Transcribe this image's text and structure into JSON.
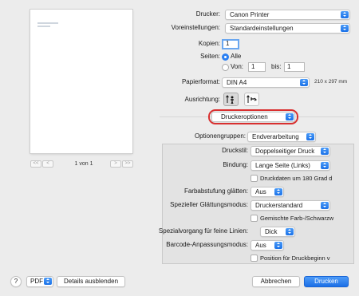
{
  "preview": {
    "first_btn": "<<",
    "prev_btn": "<",
    "page_label": "1 von 1",
    "next_btn": ">",
    "last_btn": ">>"
  },
  "printer": {
    "label": "Drucker:",
    "value": "Canon Printer"
  },
  "presets": {
    "label": "Voreinstellungen:",
    "value": "Standardeinstellungen"
  },
  "copies": {
    "label": "Kopien:",
    "value": "1"
  },
  "pages": {
    "label": "Seiten:",
    "all_label": "Alle",
    "from_label": "Von:",
    "from_value": "1",
    "to_label": "bis:",
    "to_value": "1"
  },
  "paper": {
    "label": "Papierformat:",
    "value": "DIN A4",
    "dimensions": "210 x 297 mm"
  },
  "orientation": {
    "label": "Ausrichtung:"
  },
  "section_menu": {
    "value": "Druckeroptionen"
  },
  "option_groups": {
    "label": "Optionengruppen:",
    "value": "Endverarbeitung"
  },
  "options": {
    "print_style": {
      "label": "Druckstil:",
      "value": "Doppelseitiger Druck"
    },
    "binding": {
      "label": "Bindung:",
      "value": "Lange Seite (Links)"
    },
    "rotate_180": {
      "label": "Druckdaten um 180 Grad d"
    },
    "gradation_smooth": {
      "label": "Farbabstufung glätten:",
      "value": "Aus"
    },
    "special_smoothing": {
      "label": "Spezieller Glättungsmodus:",
      "value": "Druckerstandard"
    },
    "mixed_color": {
      "label": "Gemischte Farb-/Schwarzw"
    },
    "fine_lines": {
      "label": "Spezialvorgang für feine Linien:",
      "value": "Dick"
    },
    "barcode": {
      "label": "Barcode-Anpassungsmodus:",
      "value": "Aus"
    },
    "print_start": {
      "label": "Position für Druckbeginn v"
    }
  },
  "footer": {
    "help": "?",
    "pdf": "PDF",
    "hide_details": "Details ausblenden",
    "cancel": "Abbrechen",
    "print": "Drucken"
  },
  "colors": {
    "accent": "#1b72e8",
    "highlight_ring": "#d93030"
  }
}
